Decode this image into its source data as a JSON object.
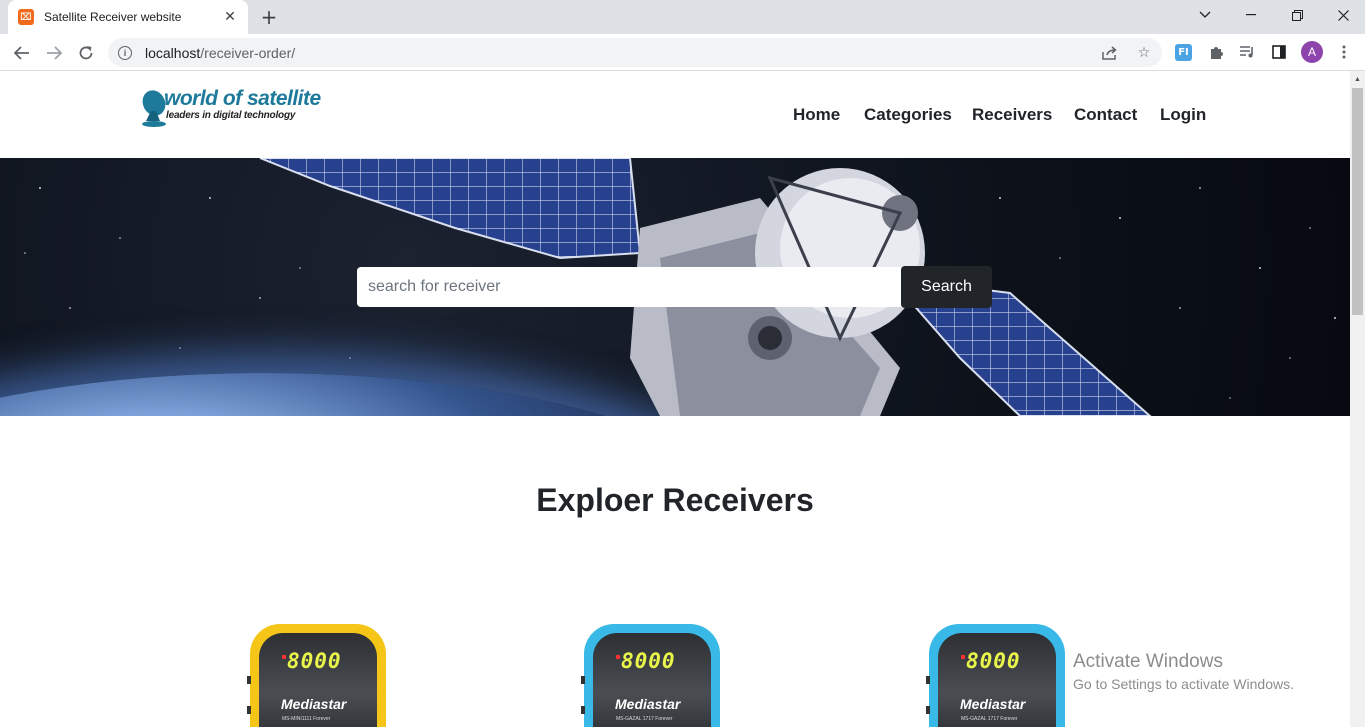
{
  "browser": {
    "tab_title": "Satellite Receiver website",
    "tab_close": "✕",
    "new_tab": "+",
    "url_host": "localhost",
    "url_path": "/receiver-order/",
    "favicon_letter": "⌧",
    "avatar_letter": "A",
    "extension_label": "FI",
    "icons": [
      "back-arrow-icon",
      "forward-arrow-icon",
      "reload-icon",
      "info-icon",
      "share-icon",
      "star-icon",
      "extension-fi-icon",
      "puzzle-icon",
      "media-icon",
      "side-panel-icon",
      "more-icon",
      "minimize-icon",
      "restore-icon",
      "close-icon",
      "chevron-down-icon"
    ]
  },
  "site": {
    "logo_title": "world of satellite",
    "logo_subtitle": "leaders in digital technology",
    "nav": [
      "Home",
      "Categories",
      "Receivers",
      "Contact",
      "Login"
    ],
    "search": {
      "placeholder": "search for receiver",
      "button": "Search"
    },
    "section_title": "Exploer Receivers",
    "products": [
      {
        "display": "8000",
        "brand": "Mediastar",
        "model": "MS-MINI1111 Forever",
        "color": "#f5c518"
      },
      {
        "display": "8000",
        "brand": "Mediastar",
        "model": "MS-GAZAL 1717 Forever",
        "color": "#39b9e8"
      },
      {
        "display": "8000",
        "brand": "Mediastar",
        "model": "MS-GAZAL 1717 Forever",
        "color": "#39b9e8"
      }
    ]
  },
  "os_watermark": {
    "title": "Activate Windows",
    "subtitle": "Go to Settings to activate Windows."
  }
}
